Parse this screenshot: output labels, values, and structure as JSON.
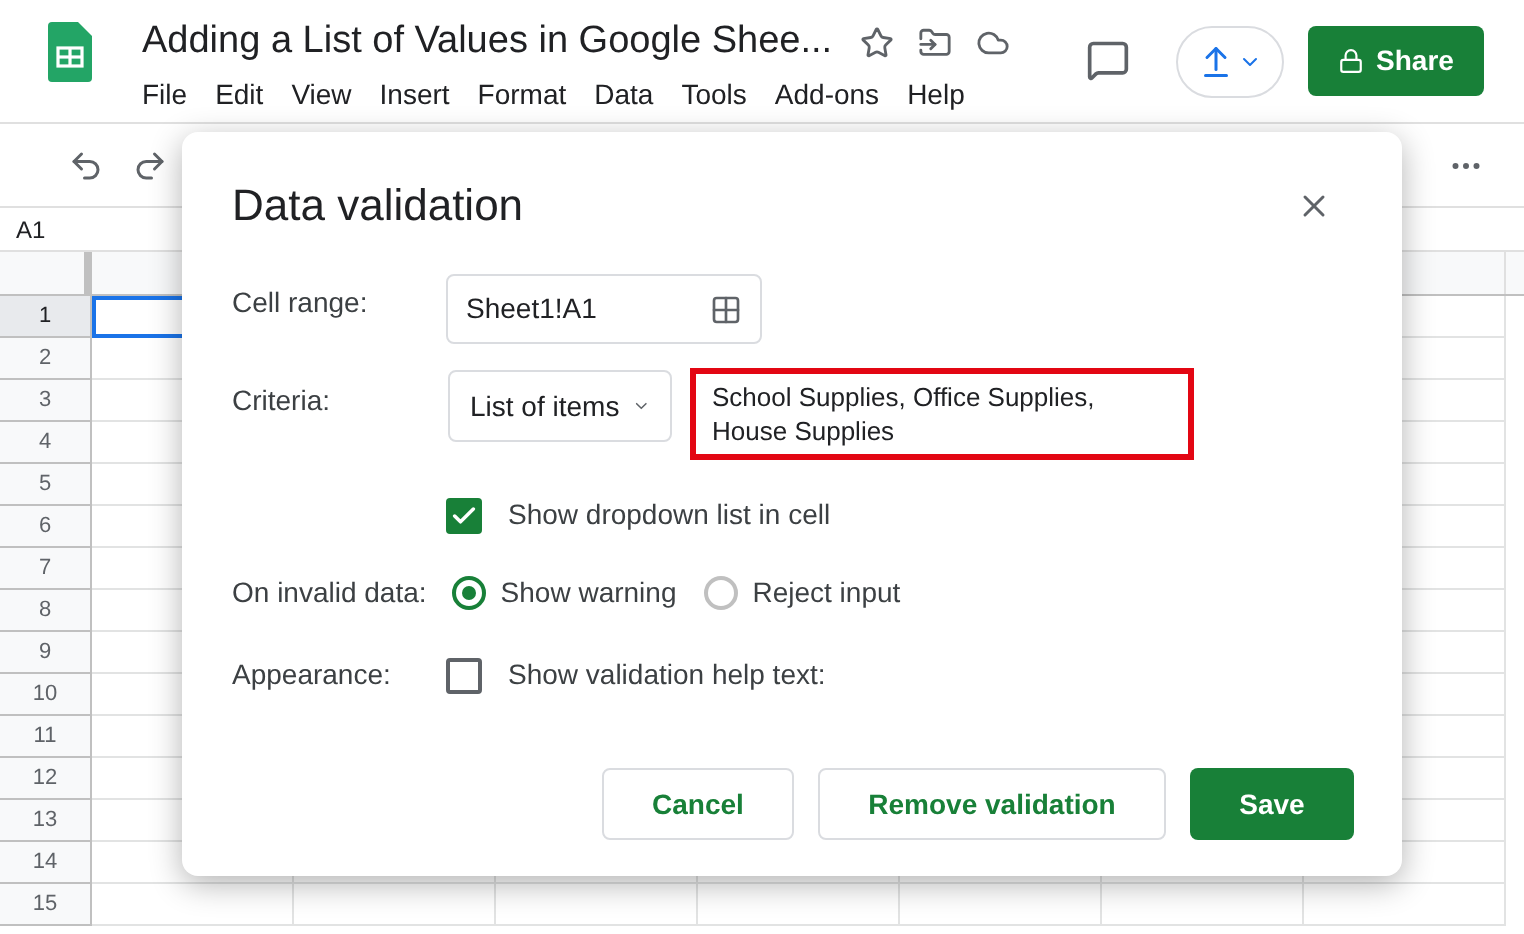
{
  "document": {
    "title": "Adding a List of Values in Google Shee...",
    "menu": [
      "File",
      "Edit",
      "View",
      "Insert",
      "Format",
      "Data",
      "Tools",
      "Add-ons",
      "Help"
    ],
    "share_button": "Share"
  },
  "name_box": "A1",
  "sheet": {
    "rows": [
      {
        "label": "1",
        "selected": true
      },
      {
        "label": "2",
        "selected": false
      },
      {
        "label": "3",
        "selected": false
      },
      {
        "label": "4",
        "selected": false
      },
      {
        "label": "5",
        "selected": false
      },
      {
        "label": "6",
        "selected": false
      },
      {
        "label": "7",
        "selected": false
      },
      {
        "label": "8",
        "selected": false
      },
      {
        "label": "9",
        "selected": false
      },
      {
        "label": "10",
        "selected": false
      },
      {
        "label": "11",
        "selected": false
      },
      {
        "label": "12",
        "selected": false
      },
      {
        "label": "13",
        "selected": false
      },
      {
        "label": "14",
        "selected": false
      },
      {
        "label": "15",
        "selected": false
      }
    ]
  },
  "dialog": {
    "title": "Data validation",
    "cell_range": {
      "label": "Cell range:",
      "value": "Sheet1!A1"
    },
    "criteria": {
      "label": "Criteria:",
      "type": "List of items",
      "value": "School Supplies, Office Supplies, House Supplies",
      "highlighted": true
    },
    "show_dropdown": {
      "label": "Show dropdown list in cell",
      "checked": true
    },
    "on_invalid": {
      "label": "On invalid data:",
      "options": [
        {
          "label": "Show warning",
          "selected": true
        },
        {
          "label": "Reject input",
          "selected": false
        }
      ]
    },
    "appearance": {
      "label": "Appearance:",
      "option": {
        "label": "Show validation help text:",
        "checked": false
      }
    },
    "buttons": [
      {
        "label": "Cancel",
        "kind": "secondary"
      },
      {
        "label": "Remove validation",
        "kind": "secondary"
      },
      {
        "label": "Save",
        "kind": "primary"
      }
    ]
  }
}
